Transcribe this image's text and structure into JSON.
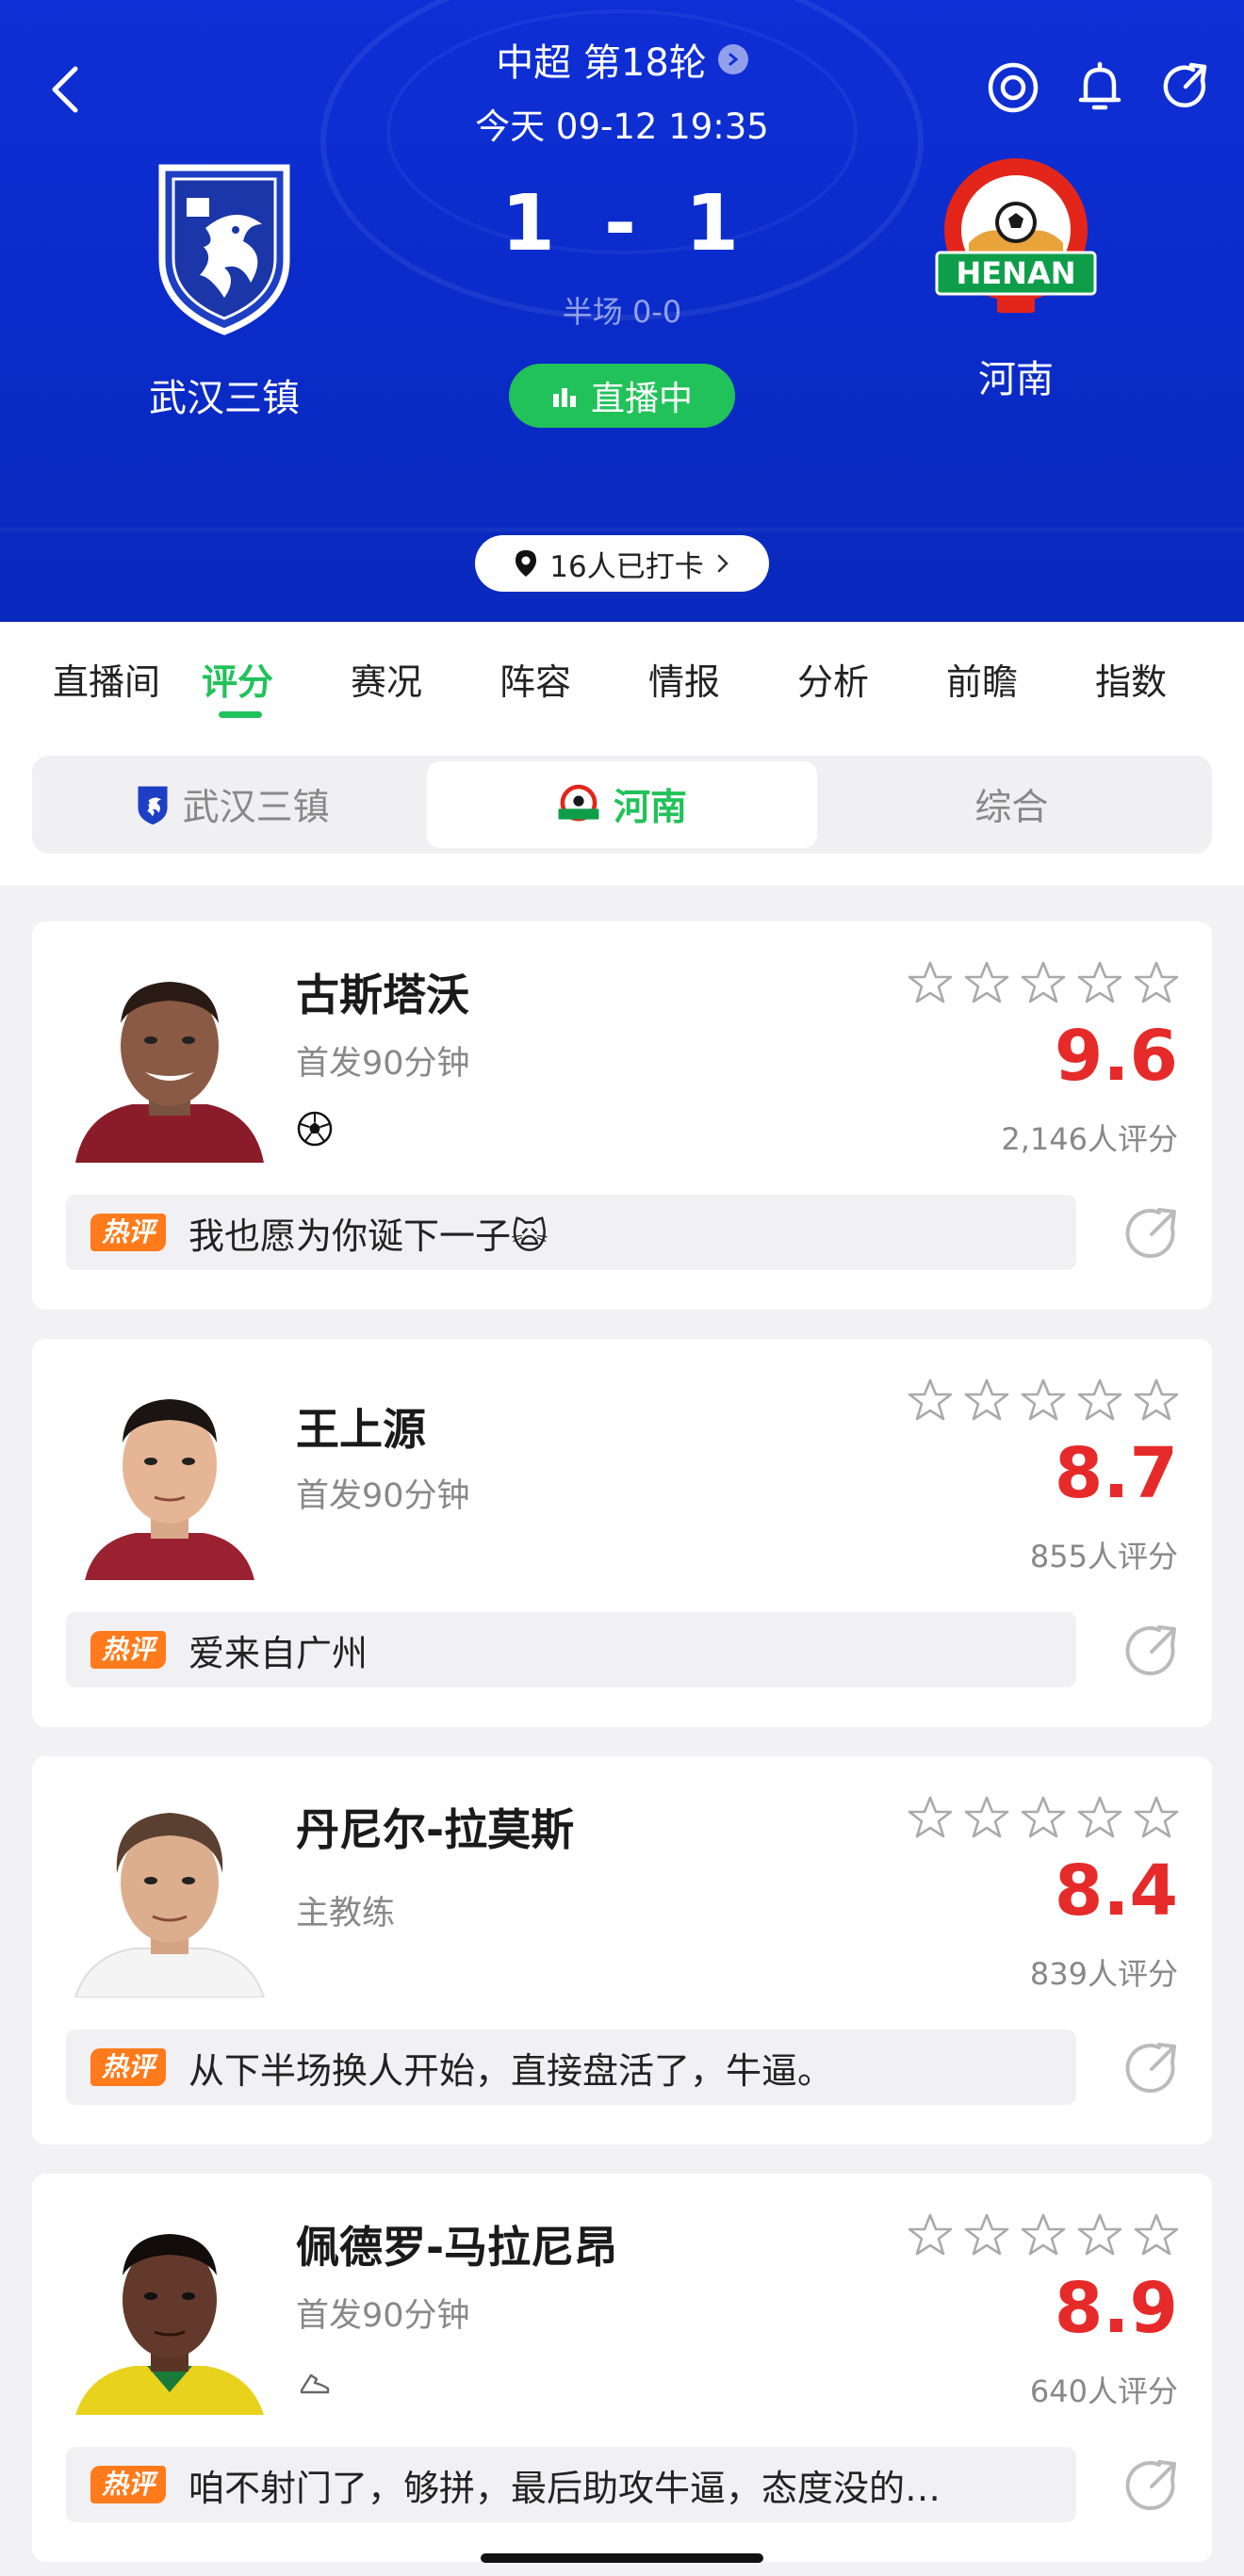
{
  "header": {
    "league": "中超 第18轮",
    "match_time": "今天 09-12 19:35",
    "score_home": "1",
    "score_sep": "-",
    "score_away": "1",
    "halftime": "半场 0-0",
    "live_label": "直播中",
    "home_team": "武汉三镇",
    "away_team": "河南",
    "checkin": "16人已打卡",
    "icons": [
      "back-arrow-icon",
      "target-icon",
      "bell-icon",
      "share-icon"
    ],
    "colors": {
      "header_bg": "#0f2fd6",
      "live_green": "#22c25a"
    }
  },
  "tabs": [
    "直播间",
    "评分",
    "赛况",
    "阵容",
    "情报",
    "分析",
    "前瞻",
    "指数"
  ],
  "active_tab": "评分",
  "segment": {
    "items": [
      "武汉三镇",
      "河南",
      "综合"
    ],
    "active": "河南"
  },
  "hot_label": "热评",
  "players": [
    {
      "name": "古斯塔沃",
      "role": "首发90分钟",
      "event_icon": "soccer-ball-icon",
      "rating": "9.6",
      "votes": "2,146人评分",
      "comment": "我也愿为你诞下一子🙀"
    },
    {
      "name": "王上源",
      "role": "首发90分钟",
      "rating": "8.7",
      "votes": "855人评分",
      "comment": "爱来自广州"
    },
    {
      "name": "丹尼尔-拉莫斯",
      "role": "主教练",
      "rating": "8.4",
      "votes": "839人评分",
      "comment": "从下半场换人开始，直接盘活了，牛逼。"
    },
    {
      "name": "佩德罗-马拉尼昂",
      "role": "首发90分钟",
      "event_icon": "boot-icon",
      "rating": "8.9",
      "votes": "640人评分",
      "comment": "咱不射门了，够拼，最后助攻牛逼，态度没的…"
    }
  ],
  "colors": {
    "rating_red": "#e62a2a",
    "hot_orange": "#ff7a1a"
  }
}
